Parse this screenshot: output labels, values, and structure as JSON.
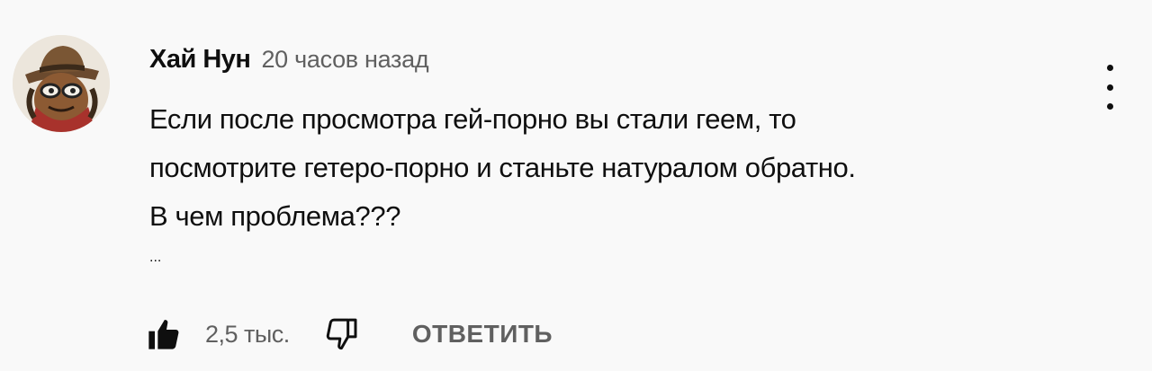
{
  "comment": {
    "author": "Хай Нун",
    "time": "20 часов назад",
    "text_lines": [
      "Если после просмотра гей-порно вы стали геем, то",
      "посмотрите гетеро-порно и станьте натуралом обратно.",
      "В чем проблема???"
    ],
    "more_indicator": "...",
    "like_count": "2,5 тыс.",
    "reply_label": "ОТВЕТИТЬ"
  },
  "icons": {
    "like": "thumb-up-filled-icon",
    "dislike": "thumb-down-outline-icon",
    "menu": "more-vertical-icon"
  },
  "colors": {
    "background": "#f9f9f9",
    "primary_text": "#0f0f0f",
    "secondary_text": "#606060"
  }
}
